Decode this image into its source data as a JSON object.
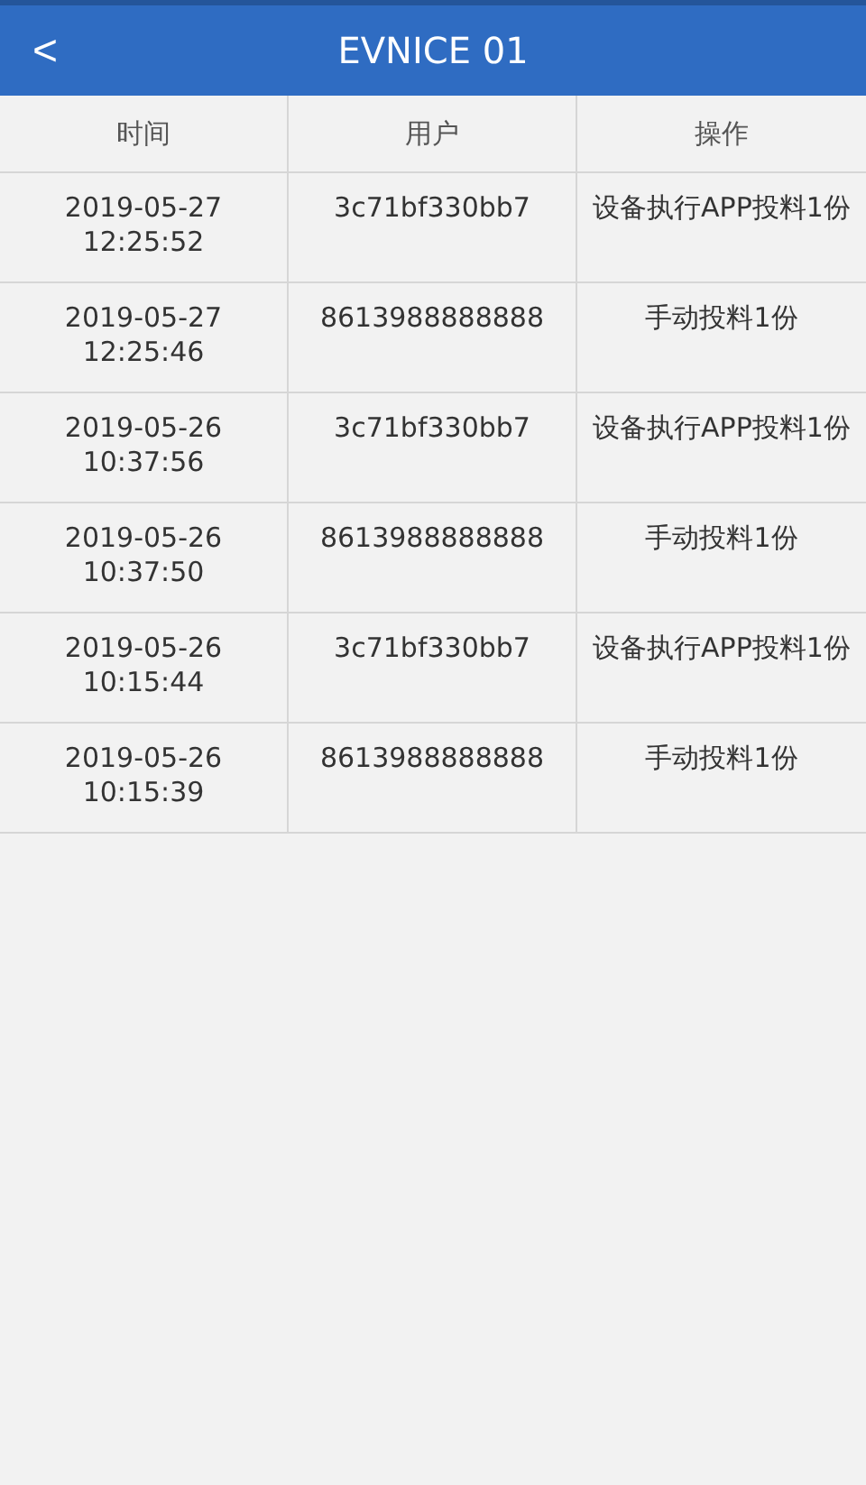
{
  "header": {
    "back": "<",
    "title": "EVNICE 01"
  },
  "table": {
    "columns": [
      "时间",
      "用户",
      "操作"
    ],
    "rows": [
      {
        "time": "2019-05-27 12:25:52",
        "user": "3c71bf330bb7",
        "action": "设备执行APP投料1份"
      },
      {
        "time": "2019-05-27 12:25:46",
        "user": "8613988888888",
        "action": "手动投料1份"
      },
      {
        "time": "2019-05-26 10:37:56",
        "user": "3c71bf330bb7",
        "action": "设备执行APP投料1份"
      },
      {
        "time": "2019-05-26 10:37:50",
        "user": "8613988888888",
        "action": "手动投料1份"
      },
      {
        "time": "2019-05-26 10:15:44",
        "user": "3c71bf330bb7",
        "action": "设备执行APP投料1份"
      },
      {
        "time": "2019-05-26 10:15:39",
        "user": "8613988888888",
        "action": "手动投料1份"
      }
    ]
  }
}
